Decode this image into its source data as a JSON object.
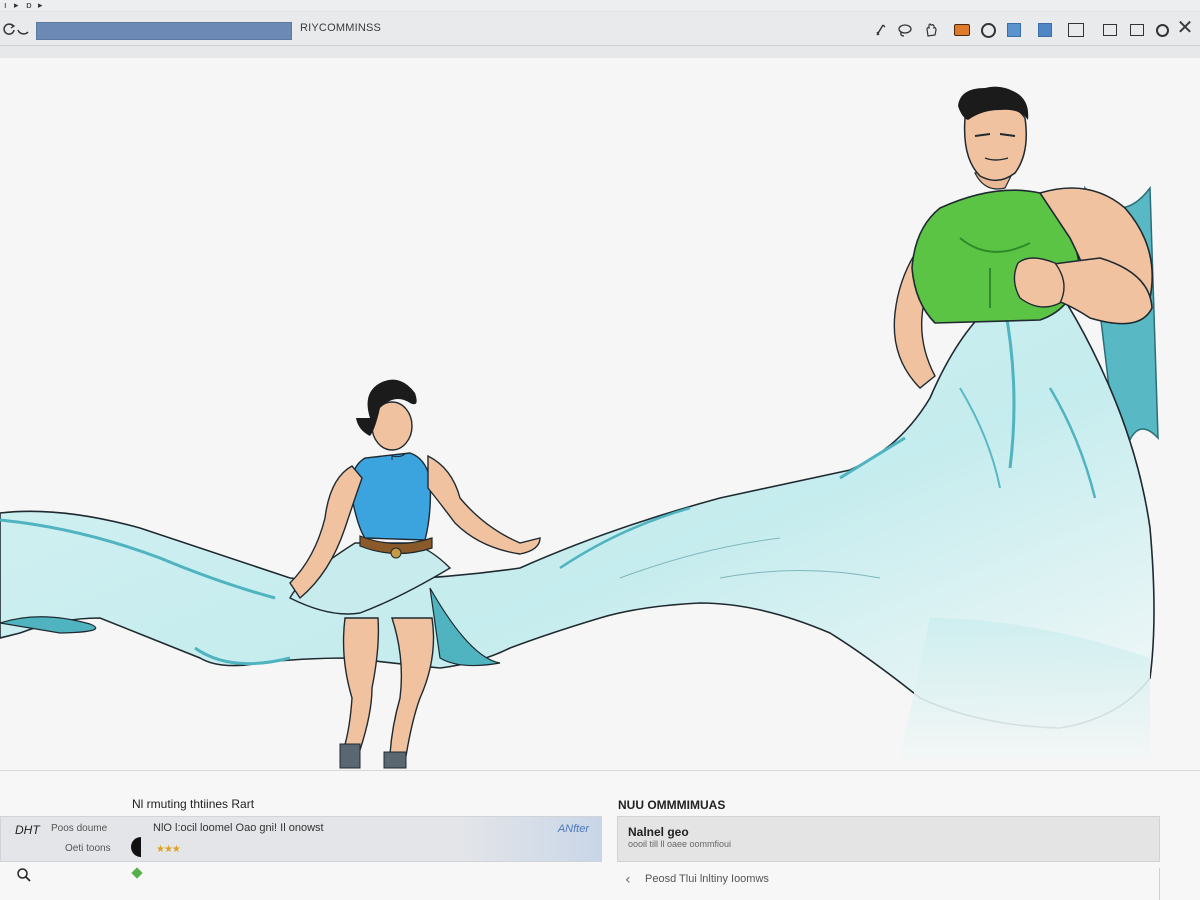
{
  "mini_strip": {
    "glyphs": [
      "ı",
      "▸",
      "ɒ",
      "▸"
    ]
  },
  "toolbar": {
    "left_icons": [
      "refresh-icon",
      "undo-icon"
    ],
    "title": "RIYCOMMINSS",
    "right_icons": [
      "pen-icon",
      "lasso-icon",
      "hand-icon",
      "camera-icon",
      "eye-icon",
      "layer-blue-icon",
      "layer-blue-alt-icon",
      "frame-icon",
      "grid-icon",
      "window-icon",
      "settings-icon",
      "close-icon"
    ],
    "close_glyph": "✕"
  },
  "canvas": {
    "subject": "illustration",
    "colors": {
      "cloth": "#c8ecee",
      "cloth_shadow": "#4fb3c0",
      "shirt_blue": "#3ba3dd",
      "shirt_green": "#5cc445",
      "skin": "#f0c2a0"
    }
  },
  "bottom": {
    "left_heading": "Nl rmuting thtiines Rart",
    "left_side_label_1": "Poos doume",
    "left_side_label_2": "Oeti toons",
    "left_corner": "DHT",
    "row_text": "NlO l:ocil loomel Oao gni! Il onowst",
    "row_link": "ANfter",
    "stars": "★★★",
    "right_heading": "NUU OMMMIMUAS",
    "right_title": "Nalnel geo",
    "right_sub": "oooil till ll oaee oommfioui",
    "footer_chevron": "‹",
    "footer_text": "Peosd Tlui lnltiny Ioomws"
  }
}
